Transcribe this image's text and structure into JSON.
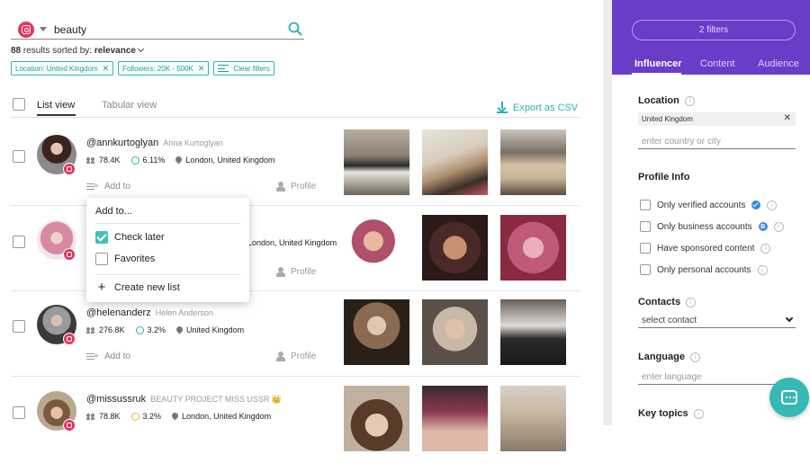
{
  "search": {
    "query": "beauty"
  },
  "results": {
    "count": "88",
    "text": " results sorted by: ",
    "sort": "relevance"
  },
  "chips": [
    {
      "label": "Location: United Kingdom"
    },
    {
      "label": "Followers: 20K - 500K"
    },
    {
      "label": "Clear filters"
    }
  ],
  "view_tabs": {
    "list": "List view",
    "tabular": "Tabular view"
  },
  "export_label": "Export as CSV",
  "row_actions": {
    "add_to": "Add to",
    "profile": "Profile"
  },
  "influencers": [
    {
      "handle": "@annkurtoglyan",
      "name": "Anna Kurtoglyan",
      "followers": "78.4K",
      "engagement": "6.11%",
      "location": "London, United Kingdom"
    },
    {
      "handle": "",
      "name": "",
      "followers": "",
      "engagement": "",
      "location": "London, United Kingdom"
    },
    {
      "handle": "@helenanderz",
      "name": "Helen Anderson",
      "followers": "276.8K",
      "engagement": "3.2%",
      "location": "United Kingdom"
    },
    {
      "handle": "@missussruk",
      "name": "BEAUTY PROJECT MISS USSR 👑",
      "followers": "78.8K",
      "engagement": "3.2%",
      "location": "London, United Kingdom"
    }
  ],
  "dropdown": {
    "title": "Add to...",
    "items": [
      {
        "label": "Check later",
        "checked": true
      },
      {
        "label": "Favorites",
        "checked": false
      }
    ],
    "create": "Create new list"
  },
  "sidebar": {
    "filters_button": "2 filters",
    "tabs": [
      "Influencer",
      "Content",
      "Audience"
    ],
    "location": {
      "title": "Location",
      "chip": "United Kingdom",
      "placeholder": "enter country or city"
    },
    "profile_info": {
      "title": "Profile Info",
      "items": [
        "Only verified accounts",
        "Only business accounts",
        "Have sponsored content",
        "Only personal accounts"
      ]
    },
    "contacts": {
      "title": "Contacts",
      "placeholder": "select contact"
    },
    "language": {
      "title": "Language",
      "placeholder": "enter language"
    },
    "key_topics": {
      "title": "Key topics"
    }
  },
  "colors": {
    "accent": "#2bb3af",
    "brand_purple": "#6a3dc8",
    "instagram": "#e6335e"
  },
  "icons": [
    "instagram-icon",
    "search-icon",
    "download-icon",
    "followers-icon",
    "engagement-icon",
    "location-pin-icon",
    "add-list-icon",
    "person-icon",
    "info-icon",
    "verified-icon",
    "business-icon",
    "chat-icon"
  ]
}
